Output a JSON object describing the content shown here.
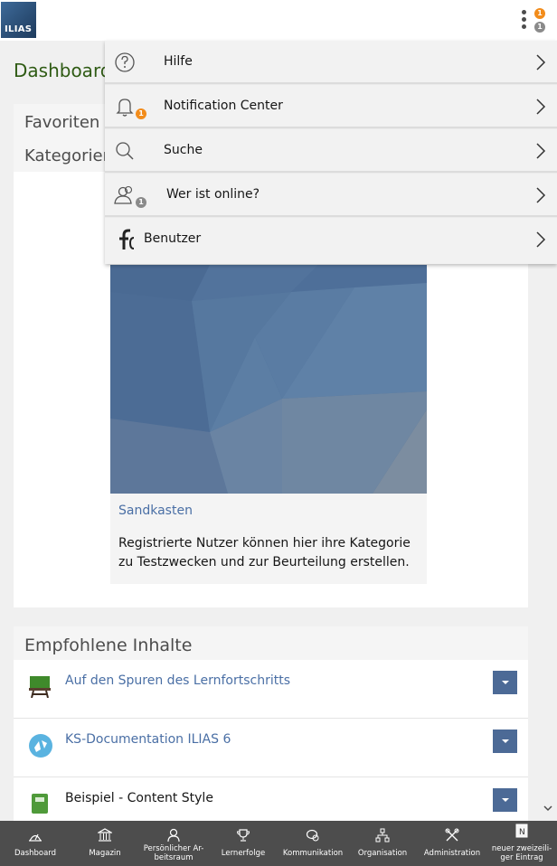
{
  "header": {
    "logo_text": "ILIAS",
    "badge_notifications": "1",
    "badge_online": "1"
  },
  "page_title": "Dashboard",
  "panel_selection": {
    "tab_favorites": "Favoriten",
    "tab_categories": "Kategorien"
  },
  "card": {
    "title": "Sandkasten",
    "description": "Registrierte Nutzer können hier ihre Kategorie zu Testzwecken und zur Beurteilung erstellen."
  },
  "recommended": {
    "title": "Empfohlene Inhalte",
    "items": [
      {
        "label": "Auf den Spuren des Lernfortschritts",
        "icon": "course-icon"
      },
      {
        "label": "KS-Documentation ILIAS 6",
        "icon": "wiki-icon"
      },
      {
        "label": "Beispiel - Content Style",
        "icon": "learning-module-icon"
      }
    ]
  },
  "menu": {
    "items": [
      {
        "label": "Hilfe",
        "icon": "help-icon"
      },
      {
        "label": "Notification Center",
        "icon": "bell-icon",
        "badge": "1"
      },
      {
        "label": "Suche",
        "icon": "search-icon"
      },
      {
        "label": "Wer ist online?",
        "icon": "users-online-icon",
        "badge": "1"
      },
      {
        "label": "Benutzer",
        "icon": "user-icon"
      }
    ]
  },
  "footer": {
    "items": [
      {
        "label": "Dashboard",
        "icon": "dashboard-icon"
      },
      {
        "label": "Magazin",
        "icon": "repository-icon"
      },
      {
        "label": "Persönlicher Ar-\nbeitsraum",
        "icon": "person-icon"
      },
      {
        "label": "Lernerfolge",
        "icon": "trophy-icon"
      },
      {
        "label": "Kommunikation",
        "icon": "chat-icon"
      },
      {
        "label": "Organisation",
        "icon": "org-icon"
      },
      {
        "label": "Administration",
        "icon": "tools-icon"
      },
      {
        "label": "neuer zweizeili-\nger Eintrag",
        "icon": "note-icon"
      }
    ]
  },
  "colors": {
    "accent_green": "#2f5b14",
    "link_blue": "#4a6fa5",
    "dropdown_blue": "#4c6a96",
    "badge_orange": "#f28c1b",
    "footer_bg": "#4d4d4d"
  }
}
